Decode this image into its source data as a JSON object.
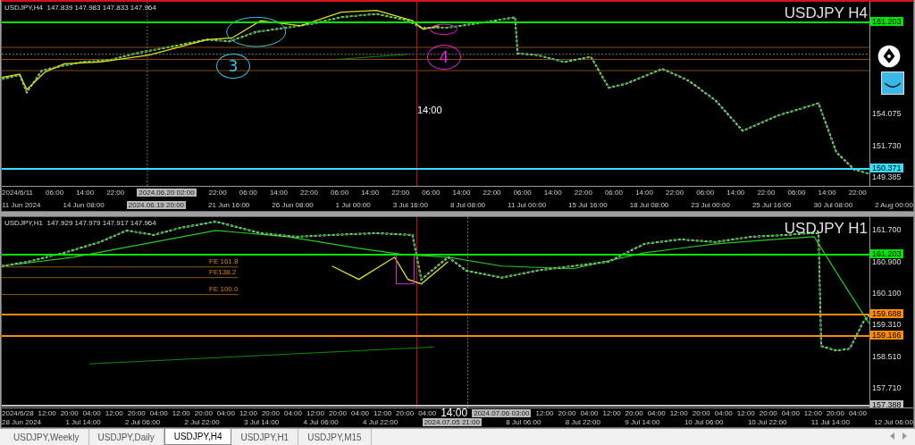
{
  "panes": [
    {
      "header": "USDJPY,H4  147.839 147.983 147.833 147.964",
      "title": "USDJPY H4",
      "crosshair_label": "14:00",
      "price_labels": [
        "154.075",
        "151.730",
        "149.385"
      ],
      "price_tags": [
        {
          "text": "161.203",
          "color": "#00e600"
        },
        {
          "text": "150.371",
          "color": "#33e0ff"
        }
      ],
      "annotations": [
        {
          "text": "3",
          "color": "#33c8e8"
        },
        {
          "text": "4",
          "color": "#e020d8"
        }
      ],
      "time_axis": {
        "row_1": [
          {
            "text": "2024/6/11",
            "kind": "tick"
          },
          {
            "text": "06:00",
            "kind": "tick"
          },
          {
            "text": "14:00",
            "kind": "tick"
          },
          {
            "text": "22:00",
            "kind": "tick"
          },
          {
            "text": "2024.06.20 02:00",
            "kind": "marker"
          },
          {
            "text": "22:00",
            "kind": "tick"
          },
          {
            "text": "06:00",
            "kind": "tick"
          },
          {
            "text": "14:00",
            "kind": "tick"
          },
          {
            "text": "22:00",
            "kind": "tick"
          },
          {
            "text": "06:00",
            "kind": "tick"
          },
          {
            "text": "14:00",
            "kind": "tick"
          },
          {
            "text": "22:00",
            "kind": "tick"
          },
          {
            "text": "06:00",
            "kind": "tick"
          },
          {
            "text": "14:00",
            "kind": "tick"
          },
          {
            "text": "22:00",
            "kind": "tick"
          },
          {
            "text": "06:00",
            "kind": "tick"
          },
          {
            "text": "14:00",
            "kind": "tick"
          },
          {
            "text": "22:00",
            "kind": "tick"
          },
          {
            "text": "06:00",
            "kind": "tick"
          },
          {
            "text": "14:00",
            "kind": "tick"
          },
          {
            "text": "22:00",
            "kind": "tick"
          },
          {
            "text": "06:00",
            "kind": "tick"
          },
          {
            "text": "14:00",
            "kind": "tick"
          },
          {
            "text": "22:00",
            "kind": "tick"
          },
          {
            "text": "06:00",
            "kind": "tick"
          },
          {
            "text": "14:00",
            "kind": "tick"
          },
          {
            "text": "22:00",
            "kind": "tick"
          }
        ],
        "row_2": [
          {
            "text": "11 Jun 2024",
            "kind": "tick"
          },
          {
            "text": "14 Jun 08:00",
            "kind": "tick"
          },
          {
            "text": "2024.06.19 20:00",
            "kind": "marker"
          },
          {
            "text": "21 Jun 16:00",
            "kind": "tick"
          },
          {
            "text": "26 Jun 08:00",
            "kind": "tick"
          },
          {
            "text": "1 Jul 00:00",
            "kind": "tick"
          },
          {
            "text": "3 Jul 16:00",
            "kind": "tick"
          },
          {
            "text": "8 Jul 08:00",
            "kind": "tick"
          },
          {
            "text": "11 Jul 00:00",
            "kind": "tick"
          },
          {
            "text": "15 Jul 16:00",
            "kind": "tick"
          },
          {
            "text": "18 Jul 08:00",
            "kind": "tick"
          },
          {
            "text": "23 Jul 00:00",
            "kind": "tick"
          },
          {
            "text": "25 Jul 16:00",
            "kind": "tick"
          },
          {
            "text": "30 Jul 08:00",
            "kind": "tick"
          },
          {
            "text": "2 Aug 00:00",
            "kind": "tick"
          }
        ]
      }
    },
    {
      "header": "USDJPY,H1  147.929 147.979 147.917 147.964",
      "title": "USDJPY H1",
      "price_labels": [
        "161.700",
        "160.900",
        "160.100",
        "159.310",
        "158.510",
        "157.710"
      ],
      "price_tags": [
        {
          "text": "161.203",
          "color": "#00e600"
        },
        {
          "text": "159.688",
          "color": "#ff8c00"
        },
        {
          "text": "159.166",
          "color": "#ff8c00"
        },
        {
          "text": "157.388",
          "color": "#c0c0c0"
        }
      ],
      "fe_labels": [
        "FE 161.8",
        "FE138.2",
        "FE 100.0"
      ],
      "time_axis": {
        "row_1": [
          {
            "text": "2024/6/28",
            "kind": "tick"
          },
          {
            "text": "12:00",
            "kind": "tick"
          },
          {
            "text": "20:00",
            "kind": "tick"
          },
          {
            "text": "04:00",
            "kind": "tick"
          },
          {
            "text": "12:00",
            "kind": "tick"
          },
          {
            "text": "20:00",
            "kind": "tick"
          },
          {
            "text": "04:00",
            "kind": "tick"
          },
          {
            "text": "12:00",
            "kind": "tick"
          },
          {
            "text": "20:00",
            "kind": "tick"
          },
          {
            "text": "04:00",
            "kind": "tick"
          },
          {
            "text": "12:00",
            "kind": "tick"
          },
          {
            "text": "20:00",
            "kind": "tick"
          },
          {
            "text": "04:00",
            "kind": "tick"
          },
          {
            "text": "12:00",
            "kind": "tick"
          },
          {
            "text": "20:00",
            "kind": "tick"
          },
          {
            "text": "04:00",
            "kind": "tick"
          },
          {
            "text": "12:00",
            "kind": "tick"
          },
          {
            "text": "20:00",
            "kind": "tick"
          },
          {
            "text": "04:00",
            "kind": "tick"
          },
          {
            "text": "14:00",
            "kind": "crosshair"
          },
          {
            "text": "2024.07.06 03:00",
            "kind": "marker"
          },
          {
            "text": "12:00",
            "kind": "tick"
          },
          {
            "text": "20:00",
            "kind": "tick"
          },
          {
            "text": "04:00",
            "kind": "tick"
          },
          {
            "text": "12:00",
            "kind": "tick"
          },
          {
            "text": "20:00",
            "kind": "tick"
          },
          {
            "text": "04:00",
            "kind": "tick"
          },
          {
            "text": "12:00",
            "kind": "tick"
          },
          {
            "text": "20:00",
            "kind": "tick"
          },
          {
            "text": "04:00",
            "kind": "tick"
          },
          {
            "text": "12:00",
            "kind": "tick"
          },
          {
            "text": "20:00",
            "kind": "tick"
          },
          {
            "text": "04:00",
            "kind": "tick"
          },
          {
            "text": "12:00",
            "kind": "tick"
          },
          {
            "text": "20:00",
            "kind": "tick"
          },
          {
            "text": "04:00",
            "kind": "tick"
          }
        ],
        "row_2": [
          {
            "text": "28 Jun 2024",
            "kind": "tick"
          },
          {
            "text": "1 Jul 14:00",
            "kind": "tick"
          },
          {
            "text": "2 Jul 06:00",
            "kind": "tick"
          },
          {
            "text": "2 Jul 22:00",
            "kind": "tick"
          },
          {
            "text": "3 Jul 14:00",
            "kind": "tick"
          },
          {
            "text": "4 Jul 06:00",
            "kind": "tick"
          },
          {
            "text": "4 Jul 22:00",
            "kind": "tick"
          },
          {
            "text": "2024.07.05 21:00",
            "kind": "marker"
          },
          {
            "text": "8 Jul 06:00",
            "kind": "tick"
          },
          {
            "text": "8 Jul 22:00",
            "kind": "tick"
          },
          {
            "text": "9 Jul 14:00",
            "kind": "tick"
          },
          {
            "text": "10 Jul 06:00",
            "kind": "tick"
          },
          {
            "text": "10 Jul 22:00",
            "kind": "tick"
          },
          {
            "text": "11 Jul 14:00",
            "kind": "tick"
          },
          {
            "text": "12 Jul 06:00",
            "kind": "tick"
          }
        ]
      }
    }
  ],
  "tabs": [
    {
      "label": "USDJPY,Weekly",
      "selected": false
    },
    {
      "label": "USDJPY,Daily",
      "selected": false
    },
    {
      "label": "USDJPY,H4",
      "selected": true
    },
    {
      "label": "USDJPY,H1",
      "selected": false
    },
    {
      "label": "USDJPY,M15",
      "selected": false
    }
  ]
}
